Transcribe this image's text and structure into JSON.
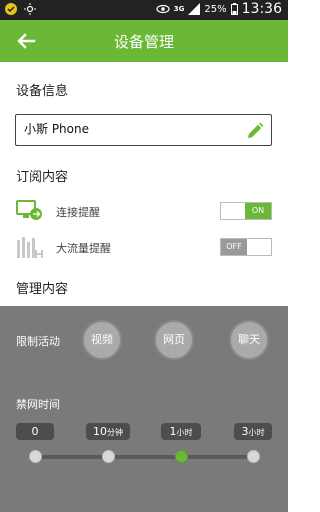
{
  "status_bar": {
    "network": "3G",
    "battery_percent": "25%",
    "time": "13:36"
  },
  "app_bar": {
    "title": "设备管理"
  },
  "device_info": {
    "section_title": "设备信息",
    "device_name": "小斯 Phone"
  },
  "subscription": {
    "section_title": "订阅内容",
    "items": [
      {
        "label": "连接提醒",
        "toggle_label": "ON",
        "state": "on"
      },
      {
        "label": "大流量提醒",
        "toggle_label": "OFF",
        "state": "off"
      }
    ]
  },
  "management": {
    "section_title": "管理内容",
    "restrict_label": "限制活动",
    "activities": [
      "视频",
      "网页",
      "聊天"
    ],
    "block_time_label": "禁网时间",
    "time_options": [
      {
        "value": "0",
        "unit": ""
      },
      {
        "value": "10",
        "unit": "分钟"
      },
      {
        "value": "1",
        "unit": "小时"
      },
      {
        "value": "3",
        "unit": "小时"
      }
    ],
    "selected_time_index": 2
  },
  "colors": {
    "accent": "#6ab835",
    "status_bar": "#222222",
    "panel": "#7a7a7a"
  }
}
